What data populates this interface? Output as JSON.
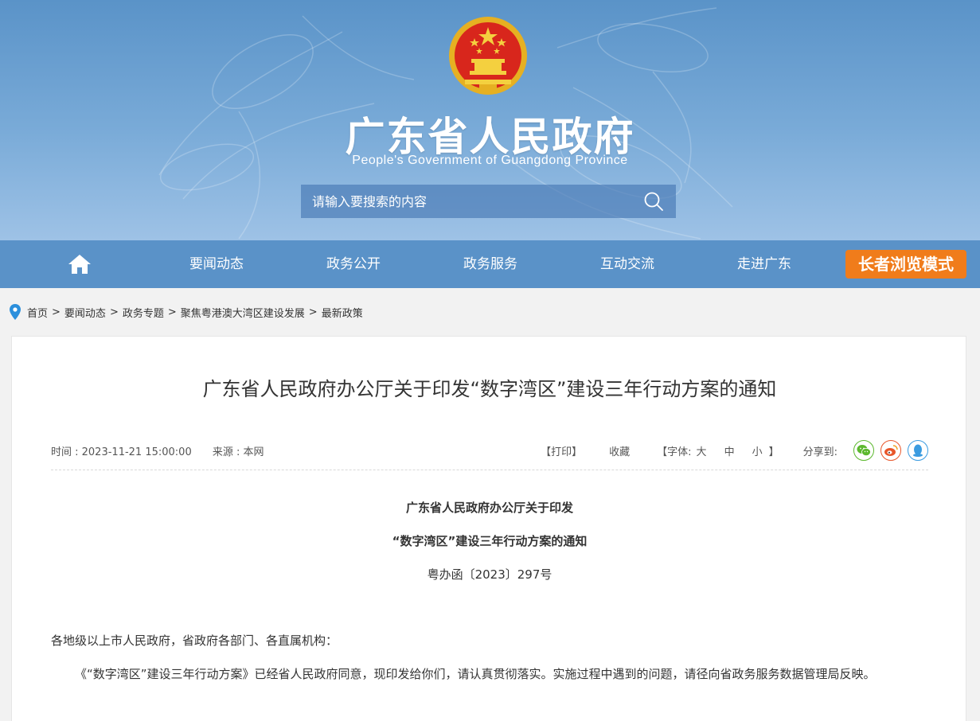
{
  "header": {
    "site_title": "广东省人民政府",
    "site_subtitle": "People's Government of Guangdong Province",
    "search_placeholder": "请输入要搜索的内容"
  },
  "nav": {
    "items": [
      {
        "label": "要闻动态"
      },
      {
        "label": "政务公开"
      },
      {
        "label": "政务服务"
      },
      {
        "label": "互动交流"
      },
      {
        "label": "走进广东"
      }
    ],
    "elder_mode": "长者浏览模式"
  },
  "breadcrumb": [
    "首页",
    "要闻动态",
    "政务专题",
    "聚焦粤港澳大湾区建设发展",
    "最新政策"
  ],
  "article": {
    "title": "广东省人民政府办公厅关于印发“数字湾区”建设三年行动方案的通知",
    "time": "时间 : 2023-11-21 15:00:00",
    "source": "来源 : 本网",
    "print": "【打印】",
    "favorite": "收藏",
    "font_label": "【字体:",
    "font_large": "大",
    "font_medium": "中",
    "font_small": "小",
    "font_close": "】",
    "share_label": "分享到:",
    "doc_heading_1": "广东省人民政府办公厅关于印发",
    "doc_heading_2": "“数字湾区”建设三年行动方案的通知",
    "doc_number": "粤办函〔2023〕297号",
    "salutation": "各地级以上市人民政府，省政府各部门、各直属机构：",
    "body": "《“数字湾区”建设三年行动方案》已经省人民政府同意，现印发给你们，请认真贯彻落实。实施过程中遇到的问题，请径向省政务服务数据管理局反映。"
  },
  "colors": {
    "nav_bg": "#5a92c8",
    "elder_btn": "#f07c1b",
    "wechat": "#5cb82e",
    "weibo": "#e8562a",
    "qq": "#3a9be0"
  }
}
